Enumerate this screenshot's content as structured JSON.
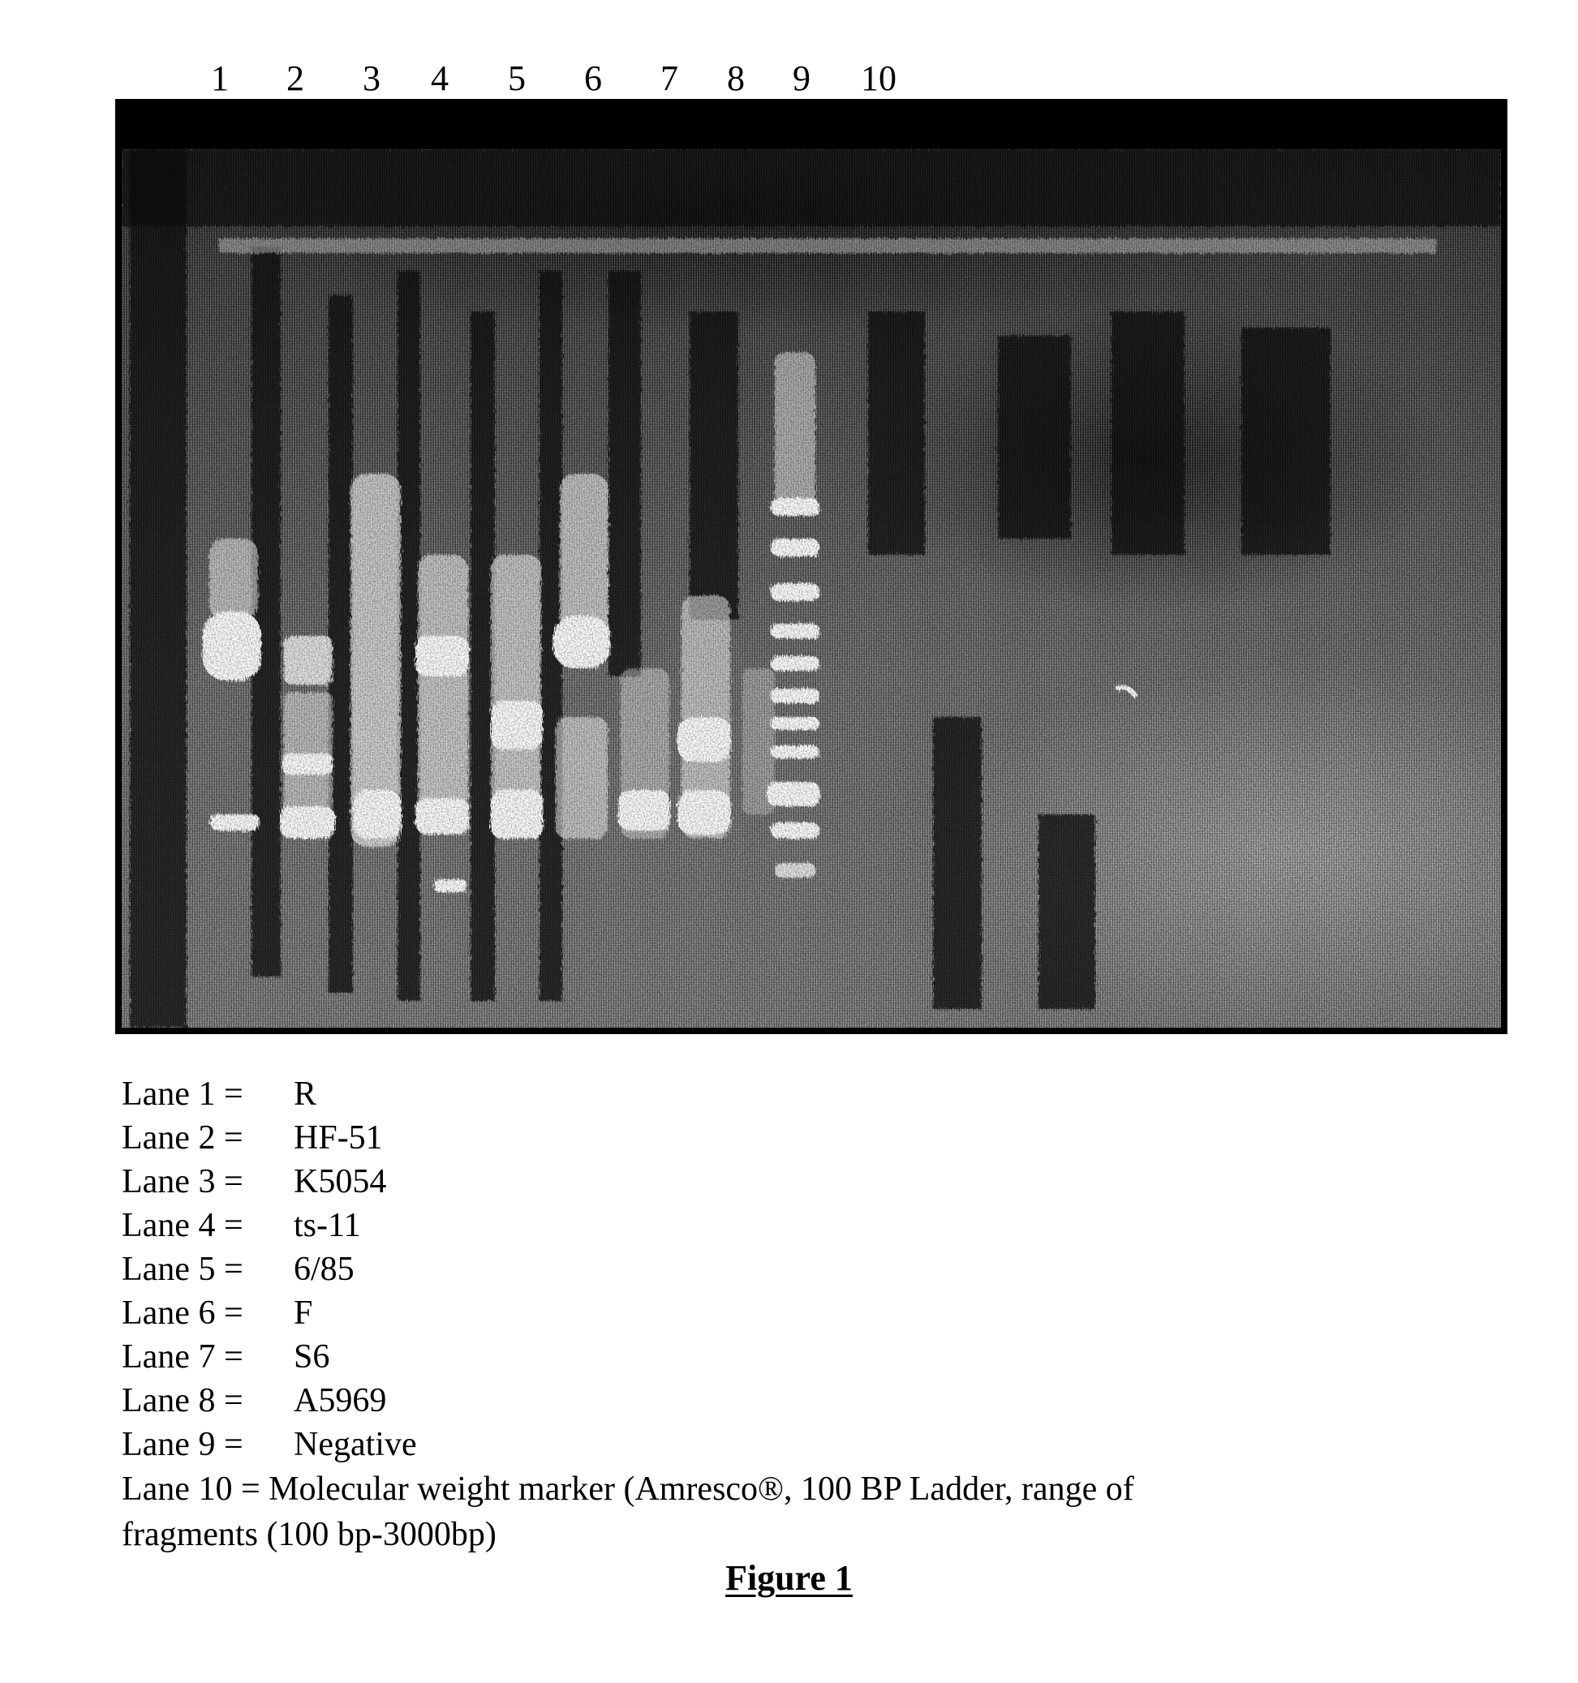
{
  "lane_numbers": [
    "1",
    "2",
    "3",
    "4",
    "5",
    "6",
    "7",
    "8",
    "9",
    "10"
  ],
  "gel": {
    "description": "Agarose gel electrophoresis image, inverted/dithered grayscale",
    "lanes": [
      {
        "lane": "1",
        "sample": "R",
        "bands": "broad bright smear with strong band mid-gel and lower band"
      },
      {
        "lane": "2",
        "sample": "HF-51",
        "bands": "multiple bright bands in lower half"
      },
      {
        "lane": "3",
        "sample": "K5054",
        "bands": "long bright smear from upper-mid to bottom"
      },
      {
        "lane": "4",
        "sample": "ts-11",
        "bands": "bright bands mid to lower, faint band near bottom"
      },
      {
        "lane": "5",
        "sample": "6/85",
        "bands": "bright bands mid to lower"
      },
      {
        "lane": "6",
        "sample": "F",
        "bands": "bright upper band and lower smear"
      },
      {
        "lane": "7",
        "sample": "S6",
        "bands": "faint lower bands"
      },
      {
        "lane": "8",
        "sample": "A5969",
        "bands": "bright lower bands"
      },
      {
        "lane": "9",
        "sample": "Negative",
        "bands": "none / faint"
      },
      {
        "lane": "10",
        "sample": "Molecular weight marker",
        "bands": "ladder of discrete bands"
      }
    ]
  },
  "legend": [
    {
      "key": "Lane 1 =",
      "value": "R"
    },
    {
      "key": "Lane 2 =",
      "value": "HF-51"
    },
    {
      "key": "Lane 3 =",
      "value": "K5054"
    },
    {
      "key": "Lane 4 =",
      "value": "ts-11"
    },
    {
      "key": "Lane 5 =",
      "value": "6/85"
    },
    {
      "key": "Lane 6 =",
      "value": "F"
    },
    {
      "key": "Lane 7 =",
      "value": "S6"
    },
    {
      "key": "Lane 8 =",
      "value": "A5969"
    },
    {
      "key": "Lane 9 =",
      "value": "Negative"
    }
  ],
  "legend_lane10_line1": "Lane 10 = Molecular weight marker (Amresco®, 100 BP Ladder, range of",
  "legend_lane10_line2": "fragments (100 bp-3000bp)",
  "figure_title": "Figure 1"
}
